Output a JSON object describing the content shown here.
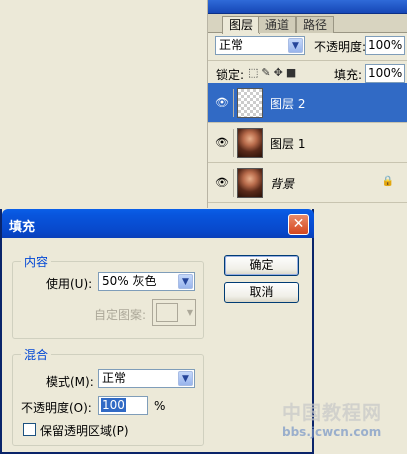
{
  "layers_panel": {
    "tabs": [
      "图层",
      "通道",
      "路径"
    ],
    "blend_mode": "正常",
    "opacity_label": "不透明度:",
    "opacity_value": "100%",
    "lock_label": "锁定:",
    "fill_label": "填充:",
    "fill_value": "100%",
    "layers": [
      {
        "name": "图层 2",
        "selected": true,
        "thumb": "transparent"
      },
      {
        "name": "图层 1",
        "selected": false,
        "thumb": "photo"
      },
      {
        "name": "背景",
        "selected": false,
        "thumb": "photo",
        "locked": true
      }
    ]
  },
  "fill_dialog": {
    "title": "填充",
    "content_group": "内容",
    "use_label": "使用(U):",
    "use_value": "50% 灰色",
    "custom_pattern_label": "自定图案:",
    "blend_group": "混合",
    "mode_label": "模式(M):",
    "mode_value": "正常",
    "opacity_label": "不透明度(O):",
    "opacity_value": "100",
    "opacity_unit": "%",
    "preserve_label": "保留透明区域(P)",
    "ok_label": "确定",
    "cancel_label": "取消"
  },
  "watermark": {
    "text": "中国教程网",
    "url": "bbs.jcwcn.com"
  }
}
